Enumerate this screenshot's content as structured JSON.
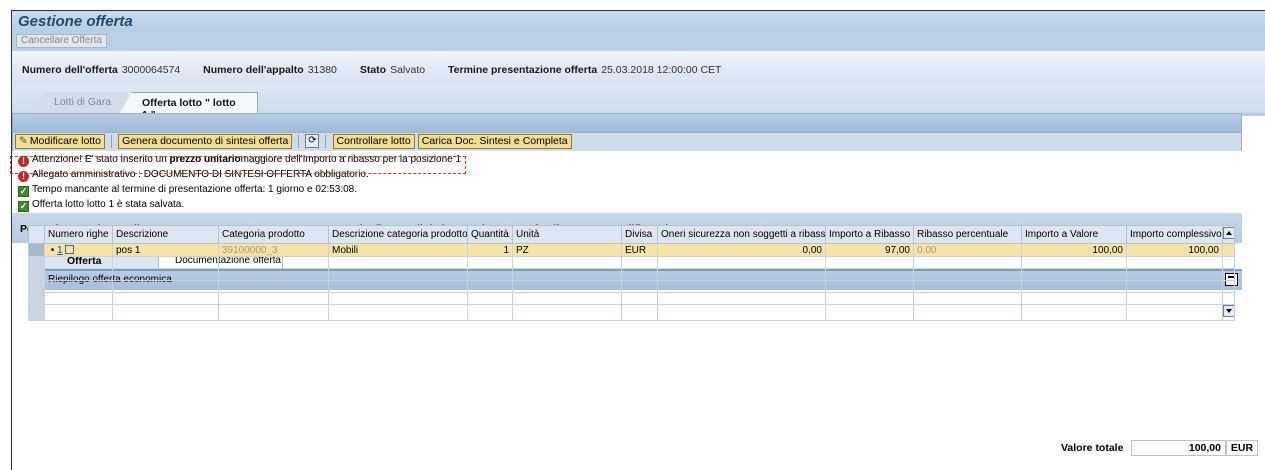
{
  "app": {
    "title": "Gestione offerta"
  },
  "actions": {
    "cancel_offer": "Cancellare Offerta"
  },
  "header": {
    "offer_number_label": "Numero dell'offerta",
    "offer_number": "3000064574",
    "tender_number_label": "Numero dell'appalto",
    "tender_number": "31380",
    "status_label": "Stato",
    "status": "Salvato",
    "deadline_label": "Termine presentazione offerta",
    "deadline": "25.03.2018 12:00:00 CET"
  },
  "top_tabs": [
    {
      "label": "Lotti di Gara",
      "active": false
    },
    {
      "label": "Offerta lotto \" lotto 1 \"",
      "active": true
    }
  ],
  "toolbar": {
    "modify": "Modificare lotto",
    "generate": "Genera documento di sintesi offerta",
    "check": "Controllare lotto",
    "upload": "Carica Doc. Sintesi e Completa"
  },
  "messages": {
    "m1_pre": "Attenzione! E' stato inserito un ",
    "m1_bold": "prezzo unitario",
    "m1_post": "maggiore dell'Importo a ribasso per la posizione 1",
    "m2": "Allegato amministrativo : DOCUMENTO DI SINTESI OFFERTA obbligatorio.",
    "m3": "Tempo mancante al termine di presentazione offerta: 1   giorno e 02:53:08.",
    "m4": "Offerta lotto lotto 1 è stata salvata."
  },
  "info_band": "Per caricare a sistema il DOCUMENTO DI SINTESI OFFERTA, una volta firmato digitalmente, è necessario cliccare su \"Modificare lotto\"",
  "sub_tabs": [
    {
      "label": "Offerta economica",
      "active": true
    },
    {
      "label": "Documentazione offerta",
      "active": false
    }
  ],
  "section": {
    "title": "Riepilogo offerta economica"
  },
  "table": {
    "columns": [
      "Numero righe",
      "Descrizione",
      "Categoria prodotto",
      "Descrizione categoria prodotto",
      "Quantità",
      "Unità",
      "Divisa",
      "Oneri sicurezza non soggetti a ribasso",
      "Importo a Ribasso",
      "Ribasso percentuale",
      "Importo a Valore",
      "Importo complessivo"
    ],
    "row": {
      "num": "1",
      "descrizione": "pos 1",
      "categoria": "39100000_3",
      "desc_categoria": "Mobili",
      "quantita": "1",
      "unita": "PZ",
      "divisa": "EUR",
      "oneri": "0,00",
      "importo_ribasso": "97,00",
      "ribasso_perc": "0,00",
      "importo_valore": "100,00",
      "importo_complessivo": "100,00"
    }
  },
  "totals": {
    "label": "Valore totale",
    "value": "100,00",
    "currency": "EUR"
  },
  "colors": {
    "button_bg": "#f1de90",
    "error": "#c62828",
    "ok": "#3d8b2a",
    "highlight_row": "#f7e3a8"
  }
}
